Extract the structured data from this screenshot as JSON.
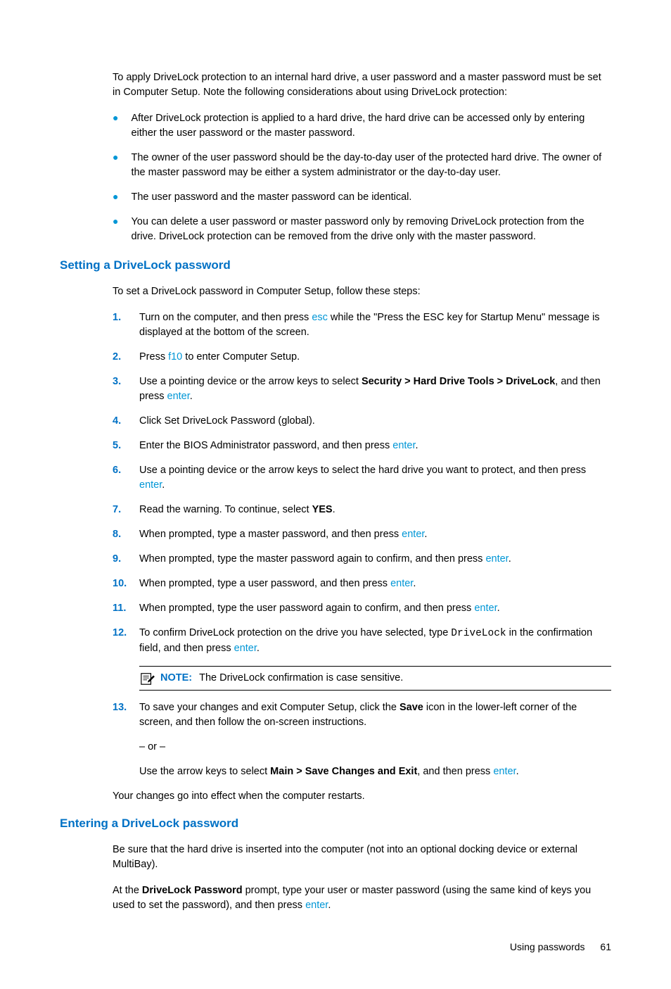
{
  "intro": "To apply DriveLock protection to an internal hard drive, a user password and a master password must be set in Computer Setup. Note the following considerations about using DriveLock protection:",
  "bullets": [
    "After DriveLock protection is applied to a hard drive, the hard drive can be accessed only by entering either the user password or the master password.",
    "The owner of the user password should be the day-to-day user of the protected hard drive. The owner of the master password may be either a system administrator or the day-to-day user.",
    "The user password and the master password can be identical.",
    "You can delete a user password or master password only by removing DriveLock protection from the drive. DriveLock protection can be removed from the drive only with the master password."
  ],
  "section1": {
    "heading": "Setting a DriveLock password",
    "para": "To set a DriveLock password in Computer Setup, follow these steps:",
    "steps": {
      "num1": "1.",
      "s1a": "Turn on the computer, and then press ",
      "s1_key": "esc",
      "s1b": " while the \"Press the ESC key for Startup Menu\" message is displayed at the bottom of the screen.",
      "num2": "2.",
      "s2a": "Press ",
      "s2_key": "f10",
      "s2b": " to enter Computer Setup.",
      "num3": "3.",
      "s3a": "Use a pointing device or the arrow keys to select ",
      "s3_bold": "Security > Hard Drive Tools > DriveLock",
      "s3b": ", and then press ",
      "s3_key": "enter",
      "s3c": ".",
      "num4": "4.",
      "s4": "Click Set DriveLock Password (global).",
      "num5": "5.",
      "s5a": "Enter the BIOS Administrator password, and then press ",
      "s5_key": "enter",
      "s5b": ".",
      "num6": "6.",
      "s6a": "Use a pointing device or the arrow keys to select the hard drive you want to protect, and then press ",
      "s6_key": "enter",
      "s6b": ".",
      "num7": "7.",
      "s7a": "Read the warning. To continue, select ",
      "s7_bold": "YES",
      "s7b": ".",
      "num8": "8.",
      "s8a": "When prompted, type a master password, and then press ",
      "s8_key": "enter",
      "s8b": ".",
      "num9": "9.",
      "s9a": "When prompted, type the master password again to confirm, and then press ",
      "s9_key": "enter",
      "s9b": ".",
      "num10": "10.",
      "s10a": "When prompted, type a user password, and then press ",
      "s10_key": "enter",
      "s10b": ".",
      "num11": "11.",
      "s11a": "When prompted, type the user password again to confirm, and then press ",
      "s11_key": "enter",
      "s11b": ".",
      "num12": "12.",
      "s12a": "To confirm DriveLock protection on the drive you have selected, type ",
      "s12_mono": "DriveLock",
      "s12b": " in the confirmation field, and then press ",
      "s12_key": "enter",
      "s12c": ".",
      "noteLabel": "NOTE:",
      "noteText": "The DriveLock confirmation is case sensitive.",
      "num13": "13.",
      "s13a": "To save your changes and exit Computer Setup, click the ",
      "s13_bold": "Save",
      "s13b": " icon in the lower-left corner of the screen, and then follow the on-screen instructions.",
      "or": "– or –",
      "s13c": "Use the arrow keys to select ",
      "s13_bold2": "Main > Save Changes and Exit",
      "s13d": ", and then press ",
      "s13_key": "enter",
      "s13e": "."
    },
    "outro": "Your changes go into effect when the computer restarts."
  },
  "section2": {
    "heading": "Entering a DriveLock password",
    "p1": "Be sure that the hard drive is inserted into the computer (not into an optional docking device or external MultiBay).",
    "p2a": "At the ",
    "p2_bold": "DriveLock Password",
    "p2b": " prompt, type your user or master password (using the same kind of keys you used to set the password), and then press ",
    "p2_key": "enter",
    "p2c": "."
  },
  "footer": {
    "title": "Using passwords",
    "page": "61"
  }
}
